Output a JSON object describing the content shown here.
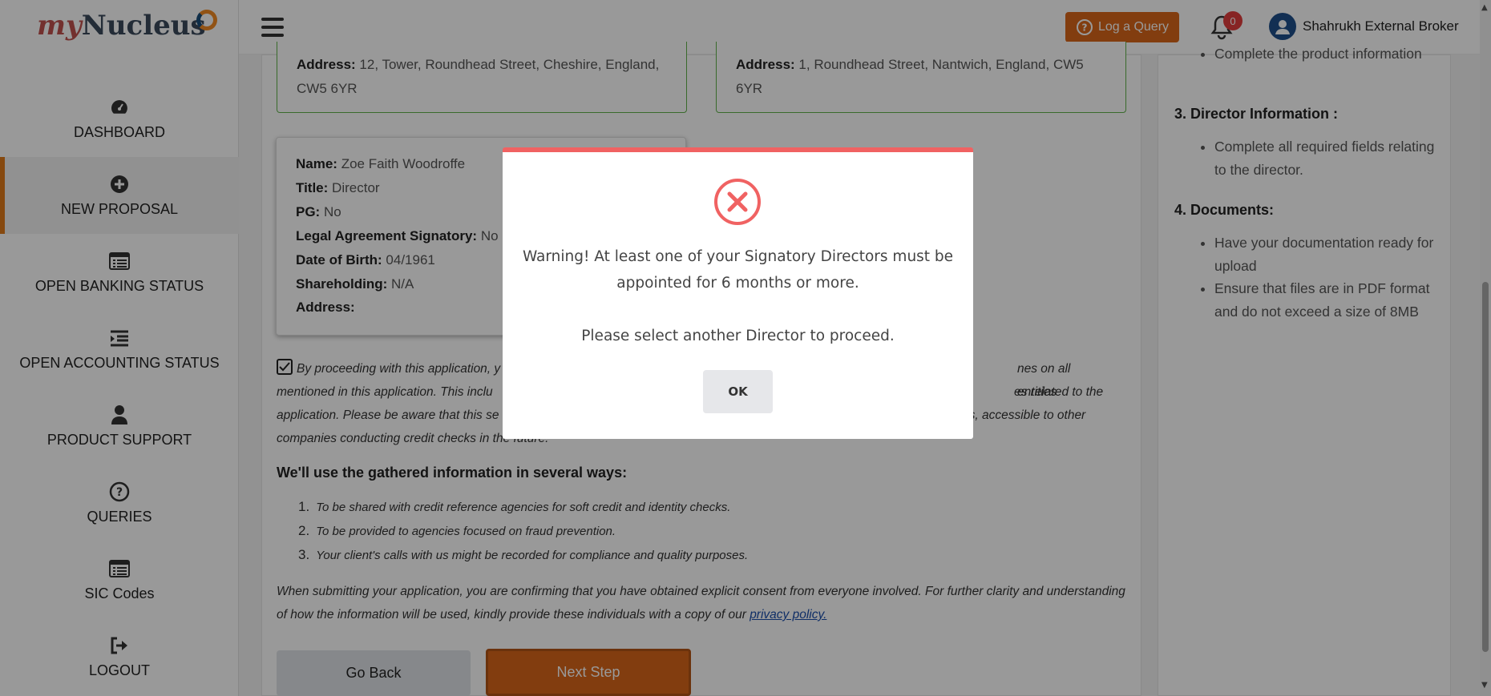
{
  "app": {
    "logo_my": "my",
    "logo_name": "Nucleus"
  },
  "sidebar": {
    "items": [
      {
        "label": "DASHBOARD",
        "icon": "dashboard-icon"
      },
      {
        "label": "NEW PROPOSAL",
        "icon": "plus-circle-icon",
        "active": true
      },
      {
        "label": "OPEN BANKING STATUS",
        "icon": "table-icon"
      },
      {
        "label": "OPEN ACCOUNTING STATUS",
        "icon": "indent-icon"
      },
      {
        "label": "PRODUCT SUPPORT",
        "icon": "user-icon"
      },
      {
        "label": "QUERIES",
        "icon": "question-icon"
      },
      {
        "label": "SIC Codes",
        "icon": "table-icon"
      },
      {
        "label": "LOGOUT",
        "icon": "logout-icon"
      }
    ]
  },
  "header": {
    "query_label": "Log a Query",
    "notification_count": "0",
    "user_name": "Shahrukh External Broker"
  },
  "address_cards": [
    {
      "label": "Address:",
      "value": "12, Tower, Roundhead Street, Cheshire, England, CW5 6YR"
    },
    {
      "label": "Address:",
      "value": "1, Roundhead Street, Nantwich, England, CW5 6YR"
    }
  ],
  "director": {
    "rows": [
      {
        "label": "Name:",
        "value": "Zoe Faith Woodroffe"
      },
      {
        "label": "Title:",
        "value": "Director"
      },
      {
        "label": "PG:",
        "value": "No"
      },
      {
        "label": "Legal Agreement Signatory:",
        "value": "No"
      },
      {
        "label": "Date of Birth:",
        "value": "04/1961"
      },
      {
        "label": "Shareholding:",
        "value": "N/A"
      },
      {
        "label": "Address:",
        "value": ""
      }
    ]
  },
  "consent": {
    "line1_left": "By proceeding with this application, y",
    "line1_right": "nes on all entities",
    "line2_left": "mentioned in this application. This inclu",
    "line2_right": "es related to the",
    "line3_left": "application. Please be aware that this se",
    "line3_right": "es, accessible to other",
    "line4_left": "companies conducting credit checks in the future."
  },
  "ways": {
    "heading": "We'll use the gathered information in several ways:",
    "items": [
      {
        "num": "1.",
        "text": "To be shared with credit reference agencies for soft credit and identity checks."
      },
      {
        "num": "2.",
        "text": "To be provided to agencies focused on fraud prevention."
      },
      {
        "num": "3.",
        "text": "Your client's calls with us might be recorded for compliance and quality purposes."
      }
    ]
  },
  "submit": {
    "text": "When submitting your application, you are confirming that you have obtained explicit consent from everyone involved. For further clarity and understanding of how the information will be used, kindly provide these individuals with a copy of our ",
    "link": "privacy policy."
  },
  "buttons": {
    "back": "Go Back",
    "next": "Next Step"
  },
  "right_panel": {
    "partial_item": "Complete the product information",
    "sections": [
      {
        "title": "3. Director Information :",
        "items": [
          "Complete all required fields relating to the director."
        ]
      },
      {
        "title": "4. Documents:",
        "items": [
          "Have your documentation ready for upload",
          "Ensure that files are in PDF format and do not exceed a size of 8MB"
        ]
      }
    ]
  },
  "modal": {
    "message": "Warning! At least one of your Signatory Directors must be appointed for 6 months or more.",
    "message2": "Please select another Director to proceed.",
    "ok": "OK",
    "accent": "#f06262"
  }
}
